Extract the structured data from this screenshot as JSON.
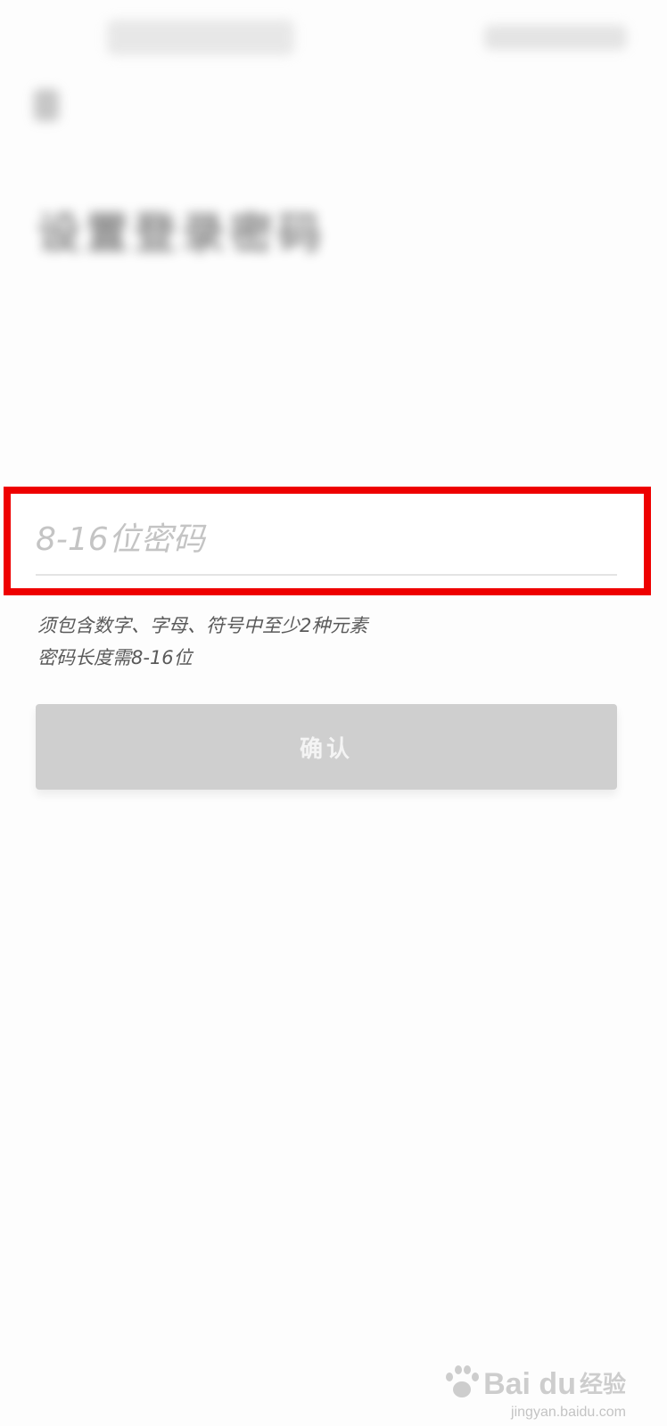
{
  "status_bar": {
    "left_text": "",
    "right_text": ""
  },
  "header": {
    "title": "设置登录密码",
    "description": ""
  },
  "password": {
    "placeholder": "8-16位密码",
    "value": ""
  },
  "hints": [
    "须包含数字、字母、符号中至少2种元素",
    "密码长度需8-16位"
  ],
  "confirm": {
    "label": "确认"
  },
  "highlight": {
    "color": "#ee0000"
  },
  "watermark": {
    "brand": "Bai du",
    "sub": "经验",
    "domain": "jingyan.baidu.com"
  }
}
